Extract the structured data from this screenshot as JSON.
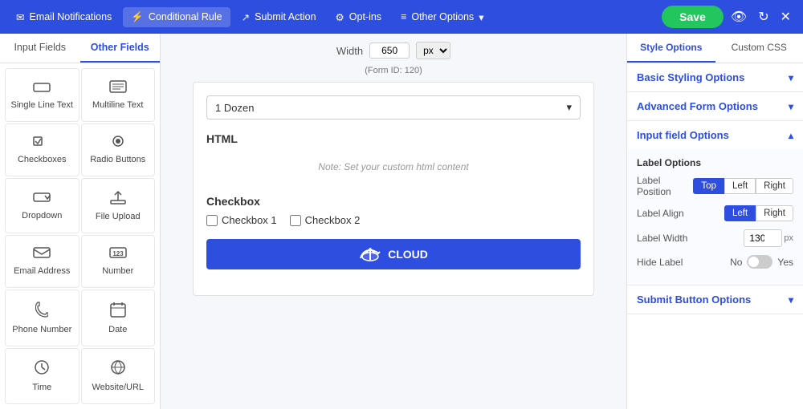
{
  "nav": {
    "items": [
      {
        "id": "email",
        "label": "Email Notifications",
        "icon": "✉"
      },
      {
        "id": "conditional",
        "label": "Conditional Rule",
        "icon": "⚡"
      },
      {
        "id": "submit",
        "label": "Submit Action",
        "icon": "↗"
      },
      {
        "id": "optins",
        "label": "Opt-ins",
        "icon": "⚙"
      },
      {
        "id": "other",
        "label": "Other Options",
        "icon": "≡",
        "dropdown": true
      }
    ],
    "save_label": "Save"
  },
  "left_panel": {
    "tab_input": "Input Fields",
    "tab_other": "Other Fields",
    "active_tab": "Other Fields",
    "fields": [
      {
        "id": "single-line",
        "label": "Single Line Text",
        "icon": "▬"
      },
      {
        "id": "multiline",
        "label": "Multiline Text",
        "icon": "▤"
      },
      {
        "id": "checkboxes",
        "label": "Checkboxes",
        "icon": "☑"
      },
      {
        "id": "radio",
        "label": "Radio Buttons",
        "icon": "◉"
      },
      {
        "id": "dropdown",
        "label": "Dropdown",
        "icon": "⌄"
      },
      {
        "id": "file-upload",
        "label": "File Upload",
        "icon": "↑"
      },
      {
        "id": "email",
        "label": "Email Address",
        "icon": "✉"
      },
      {
        "id": "number",
        "label": "Number",
        "icon": "123"
      },
      {
        "id": "phone",
        "label": "Phone Number",
        "icon": "☏"
      },
      {
        "id": "date",
        "label": "Date",
        "icon": "📅"
      },
      {
        "id": "time",
        "label": "Time",
        "icon": "⏱"
      },
      {
        "id": "website",
        "label": "Website/URL",
        "icon": "🔗"
      }
    ]
  },
  "canvas": {
    "width_label": "Width",
    "width_value": "650",
    "px_label": "px",
    "form_id_text": "(Form ID: 120)",
    "dropdown_value": "1 Dozen",
    "html_section_label": "HTML",
    "html_note": "Note: Set your custom html content",
    "checkbox_section_label": "Checkbox",
    "checkbox1_label": "Checkbox 1",
    "checkbox2_label": "Checkbox 2",
    "submit_btn_label": "CLOUD",
    "submit_btn_icon": "☁"
  },
  "right_panel": {
    "tab_style": "Style Options",
    "tab_css": "Custom CSS",
    "active_tab": "Style Options",
    "accordion": [
      {
        "id": "basic",
        "label": "Basic Styling Options",
        "open": false
      },
      {
        "id": "advanced",
        "label": "Advanced Form Options",
        "open": false
      },
      {
        "id": "input",
        "label": "Input field Options",
        "open": true
      }
    ],
    "input_options": {
      "section_label": "Label Options",
      "label_position": {
        "label": "Label Position",
        "options": [
          "Top",
          "Left",
          "Right"
        ],
        "active": "Top"
      },
      "label_align": {
        "label": "Label Align",
        "options": [
          "Left",
          "Right"
        ],
        "active": "Left"
      },
      "label_width": {
        "label": "Label Width",
        "value": "130",
        "unit": "px"
      },
      "hide_label": {
        "label": "Hide Label",
        "no": "No",
        "yes": "Yes",
        "checked": false
      }
    },
    "submit_section_label": "Submit Button Options"
  }
}
